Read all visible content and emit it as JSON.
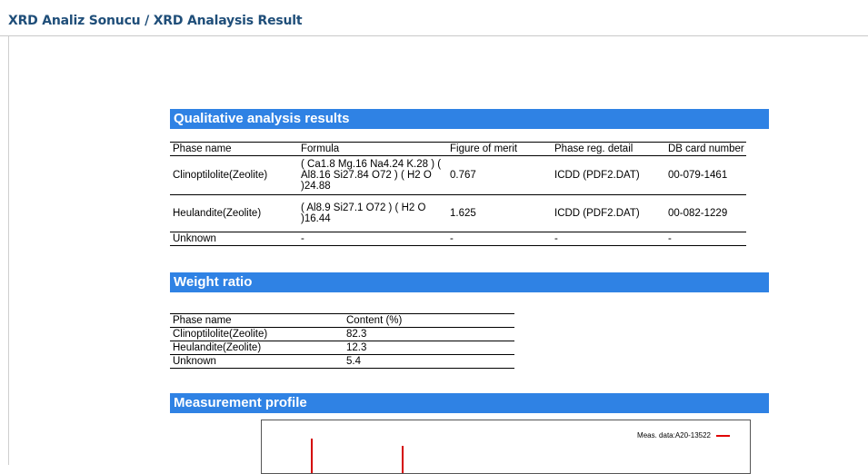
{
  "header": {
    "title": "XRD Analiz Sonucu / XRD Analaysis Result"
  },
  "qualitative": {
    "title": "Qualitative analysis results",
    "columns": [
      "Phase name",
      "Formula",
      "Figure of merit",
      "Phase reg. detail",
      "DB card number"
    ],
    "rows": [
      {
        "phase": "Clinoptilolite(Zeolite)",
        "formula": "( Ca1.8 Mg.16 Na4.24 K.28 ) ( Al8.16 Si27.84 O72 ) ( H2 O )24.88",
        "merit": "0.767",
        "detail": "ICDD (PDF2.DAT)",
        "card": "00-079-1461"
      },
      {
        "phase": "Heulandite(Zeolite)",
        "formula": "( Al8.9 Si27.1 O72 ) ( H2 O )16.44",
        "merit": "1.625",
        "detail": "ICDD (PDF2.DAT)",
        "card": "00-082-1229"
      },
      {
        "phase": "Unknown",
        "formula": "-",
        "merit": "-",
        "detail": "-",
        "card": "-"
      }
    ]
  },
  "weight": {
    "title": "Weight ratio",
    "columns": [
      "Phase name",
      "Content (%)"
    ],
    "rows": [
      {
        "phase": "Clinoptilolite(Zeolite)",
        "content": "82.3"
      },
      {
        "phase": "Heulandite(Zeolite)",
        "content": "12.3"
      },
      {
        "phase": "Unknown",
        "content": "5.4"
      }
    ]
  },
  "profile": {
    "title": "Measurement profile",
    "legend": "Meas. data:A20-13522",
    "line_color": "#e00000"
  }
}
